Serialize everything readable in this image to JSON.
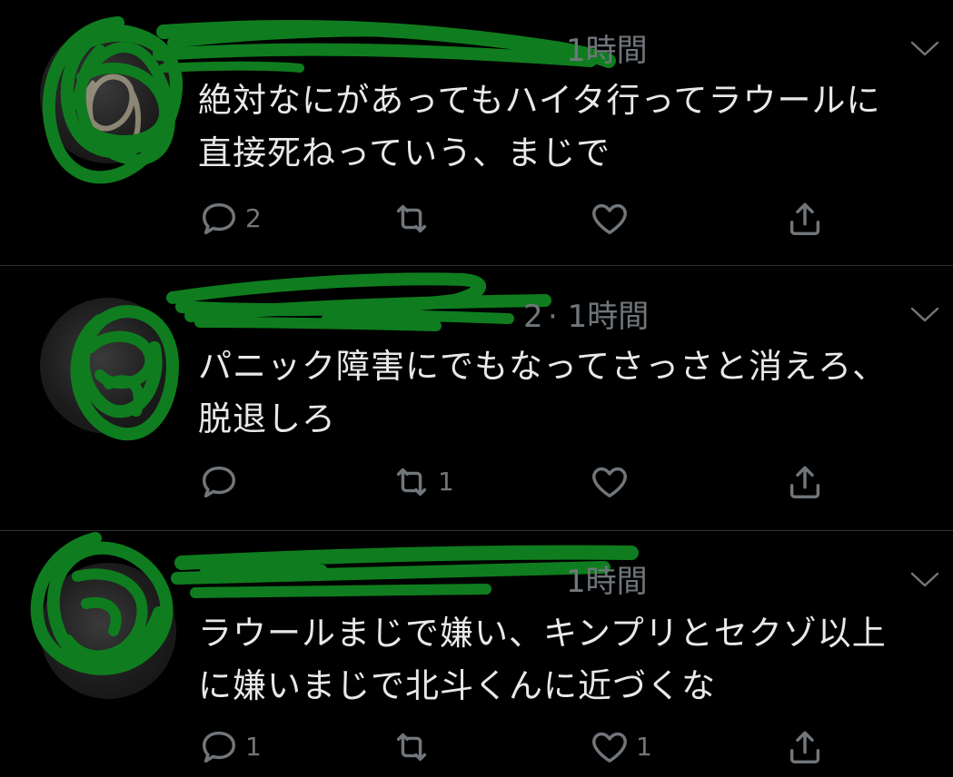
{
  "tweets": [
    {
      "handle": "",
      "time": "1時間",
      "line1": "絶対なにがあってもハイタ行ってラウールに",
      "line2": "直接死ねっていう、まじで",
      "reply_count": "2",
      "retweet_count": "",
      "like_count": ""
    },
    {
      "handle": "2",
      "time": "· 1時間",
      "line1": "パニック障害にでもなってさっさと消えろ、",
      "line2": "脱退しろ",
      "reply_count": "",
      "retweet_count": "1",
      "like_count": ""
    },
    {
      "handle": "",
      "time": "1時間",
      "line1": "ラウールまじで嫌い、キンプリとセクゾ以上",
      "line2": "に嫌いまじで北斗くんに近づくな",
      "reply_count": "1",
      "retweet_count": "",
      "like_count": "1"
    }
  ],
  "colors": {
    "background": "#000000",
    "text": "#e7e9ea",
    "secondary": "#71767b",
    "divider": "#2f3336",
    "scribble": "#0f7d1f"
  },
  "icons": [
    "reply-icon",
    "retweet-icon",
    "like-icon",
    "share-icon",
    "chevron-down-icon"
  ]
}
